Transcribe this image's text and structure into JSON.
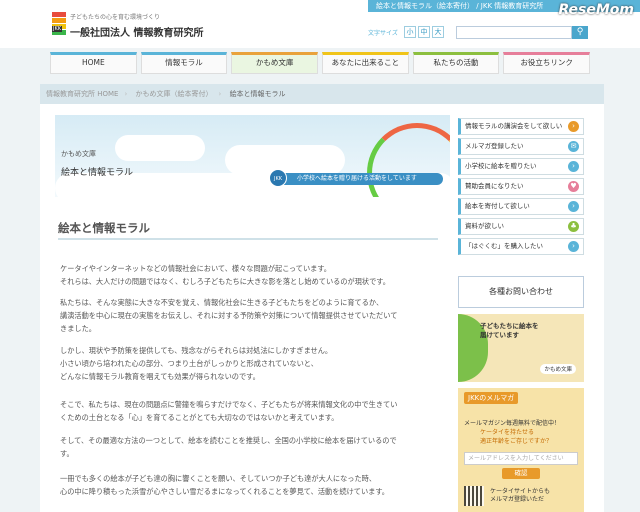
{
  "header": {
    "tagline": "子どもたちの心を育む環境づくり",
    "org_name": "一般社団法人 情報教育研究所",
    "logo_abbr": "JKK",
    "banner": "絵本と情報モラル（絵本寄付） / JKK 情報教育研究所",
    "watermark": "ReseMom",
    "font_size_label": "文字サイズ",
    "font_sizes": [
      "小",
      "中",
      "大"
    ],
    "search_placeholder": "",
    "search_icon": "search-icon",
    "logo_colors": [
      "#e84c3d",
      "#f39c12",
      "#f1c40f",
      "#3ab54a",
      "#2e86c1"
    ]
  },
  "nav": {
    "items": [
      "HOME",
      "情報モラル",
      "かもめ文庫",
      "あなたに出来ること",
      "私たちの活動",
      "お役立ちリンク"
    ],
    "active_index": 2
  },
  "breadcrumb": {
    "items": [
      "情報教育研究所 HOME",
      "かもめ文庫（絵本寄付）",
      "絵本と情報モラル"
    ]
  },
  "hero": {
    "subtitle": "かもめ文庫",
    "title": "絵本と情報モラル",
    "ribbon": "小学校へ絵本を贈り届ける活動をしています",
    "badge": "JKK"
  },
  "main": {
    "heading": "絵本と情報モラル",
    "paragraphs": [
      [
        "ケータイやインターネットなどの情報社会において、様々な問題が起こっています。",
        "それらは、大人だけの問題ではなく、むしろ子どもたちに大きな影を落とし始めているのが現状です。"
      ],
      [
        "私たちは、そんな実態に大きな不安を覚え、情報化社会に生きる子どもたちをどのように育てるか、",
        "講演活動を中心に現在の実態をお伝えし、それに対する予防策や対策について情報提供させていただいて",
        "きました。"
      ],
      [
        "しかし、現状や予防策を提供しても、残念ながらそれらは対処法にしかすぎません。",
        "小さい頃から培われた心の部分、つまり土台がしっかりと形成されていないと、",
        "どんなに情報モラル教育を唱えても効果が得られないのです。"
      ],
      [
        "そこで、私たちは、現在の問題点に警鐘を鳴らすだけでなく、子どもたちが将来情報文化の中で生きてい",
        "くための土台となる「心」を育てることがとても大切なのではないかと考えています。"
      ],
      [
        "そして、その最適な方法の一つとして、絵本を読むことを推奨し、全国の小学校に絵本を届けているので",
        "す。"
      ],
      [
        "一冊でも多くの絵本が子ども達の胸に響くことを願い、そしていつか子ども達が大人になった時、",
        "心の中に降り積もった浜雪が心やさしい雪だるまになってくれることを夢見て、活動を続けています。"
      ]
    ]
  },
  "sidebar": {
    "links": [
      {
        "label": "情報モラルの講演会をして欲しい",
        "icon": "megaphone-icon",
        "color": "#e89a2a"
      },
      {
        "label": "メルマガ登録したい",
        "icon": "mail-icon",
        "color": "#5ab4d8"
      },
      {
        "label": "小学校に絵本を贈りたい",
        "icon": "book-icon",
        "color": "#5ab4d8"
      },
      {
        "label": "賛助会員になりたい",
        "icon": "heart-icon",
        "color": "#e67e9a"
      },
      {
        "label": "絵本を寄付して欲しい",
        "icon": "book-icon",
        "color": "#5ab4d8"
      },
      {
        "label": "資料が欲しい",
        "icon": "clover-icon",
        "color": "#8cbf3f"
      },
      {
        "label": "「はぐくむ」を購入したい",
        "icon": "book-icon",
        "color": "#5ab4d8"
      }
    ],
    "contact": "各種お問い合わせ",
    "promo": {
      "line1": "子どもたちに絵本を",
      "line2": "届けています",
      "sign": "かもめ文庫"
    },
    "mailmag": {
      "title": "JKKのメルマガ",
      "line1": "メールマガジン毎週無料で配信中！",
      "line2a": "ケータイを持たせる",
      "line2b": "適正年齢をご存じですか？",
      "input_placeholder": "メールアドレスを入力してください",
      "submit": "確認",
      "foot1": "ケータイサイトからも",
      "foot2": "メルマガ登録いただ"
    }
  }
}
